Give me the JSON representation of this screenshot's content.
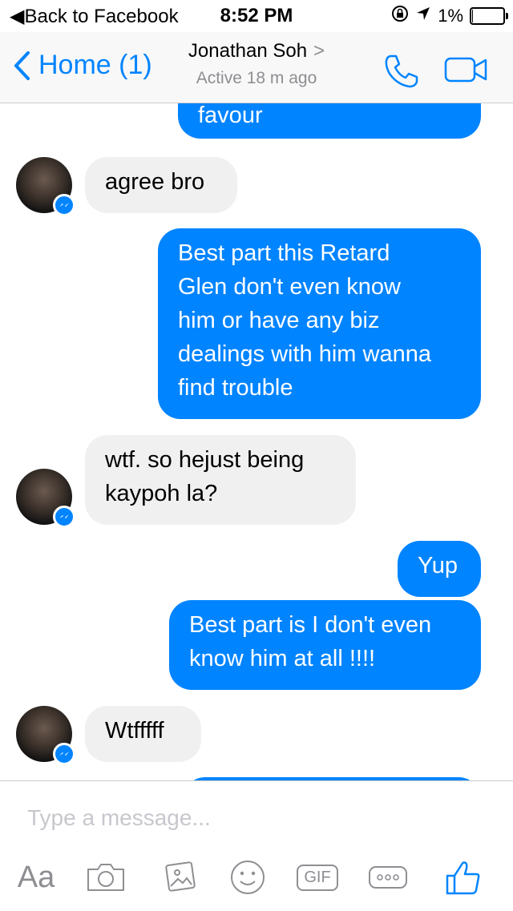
{
  "status_bar": {
    "back_label": "Back to Facebook",
    "time": "8:52 PM",
    "battery_percent": "1%",
    "battery_level": 0.01
  },
  "header": {
    "back_label": "Home (1)",
    "contact_name": "Jonathan Soh",
    "active_status": "Active 18 m ago"
  },
  "messages": [
    {
      "sender": "me",
      "lines": [
        "favour"
      ]
    },
    {
      "sender": "them",
      "lines": [
        "agree bro"
      ]
    },
    {
      "sender": "me",
      "lines": [
        "Best part this Retard",
        "Glen don't even know",
        "him or have any biz",
        "dealings with him wanna",
        "find trouble"
      ]
    },
    {
      "sender": "them",
      "lines": [
        "wtf.  so hejust being",
        "kaypoh la?"
      ]
    },
    {
      "sender": "me",
      "lines": [
        "Yup"
      ]
    },
    {
      "sender": "me",
      "lines": [
        "Best part is I don't even",
        "know him at all !!!!"
      ]
    },
    {
      "sender": "them",
      "lines": [
        "Wtfffff"
      ]
    }
  ],
  "composer": {
    "placeholder": "Type a message...",
    "tools": [
      "text-format-icon",
      "camera-icon",
      "photo-icon",
      "emoji-icon",
      "gif-icon",
      "more-icon",
      "like-icon"
    ],
    "text_tool_label": "Aa",
    "gif_label": "GIF"
  },
  "colors": {
    "accent": "#0084ff",
    "incoming_bubble": "#f1f0f0",
    "muted": "#8e8e93"
  }
}
